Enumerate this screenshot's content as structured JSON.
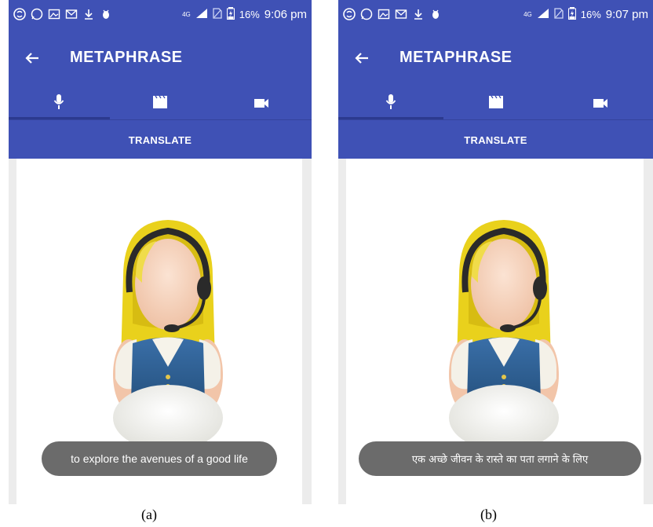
{
  "screens": [
    {
      "status": {
        "network": "4G",
        "battery": "16%",
        "time": "9:06 pm"
      },
      "app_title": "METAPHRASE",
      "tabs": [
        {
          "icon": "mic-icon",
          "active": true
        },
        {
          "icon": "clapperboard-icon",
          "active": false
        },
        {
          "icon": "videocam-icon",
          "active": false
        }
      ],
      "translate_label": "TRANSLATE",
      "toast_text": "to explore the avenues of a good life",
      "caption": "(a)"
    },
    {
      "status": {
        "network": "4G",
        "battery": "16%",
        "time": "9:07 pm"
      },
      "app_title": "METAPHRASE",
      "tabs": [
        {
          "icon": "mic-icon",
          "active": true
        },
        {
          "icon": "clapperboard-icon",
          "active": false
        },
        {
          "icon": "videocam-icon",
          "active": false
        }
      ],
      "translate_label": "TRANSLATE",
      "toast_text": "एक अच्छे जीवन के रास्ते का पता लगाने के लिए",
      "caption": "(b)"
    }
  ],
  "colors": {
    "primary": "#3f51b5",
    "toast": "#6b6b6b",
    "hair": "#e9d11c",
    "vest": "#2f5f95"
  }
}
